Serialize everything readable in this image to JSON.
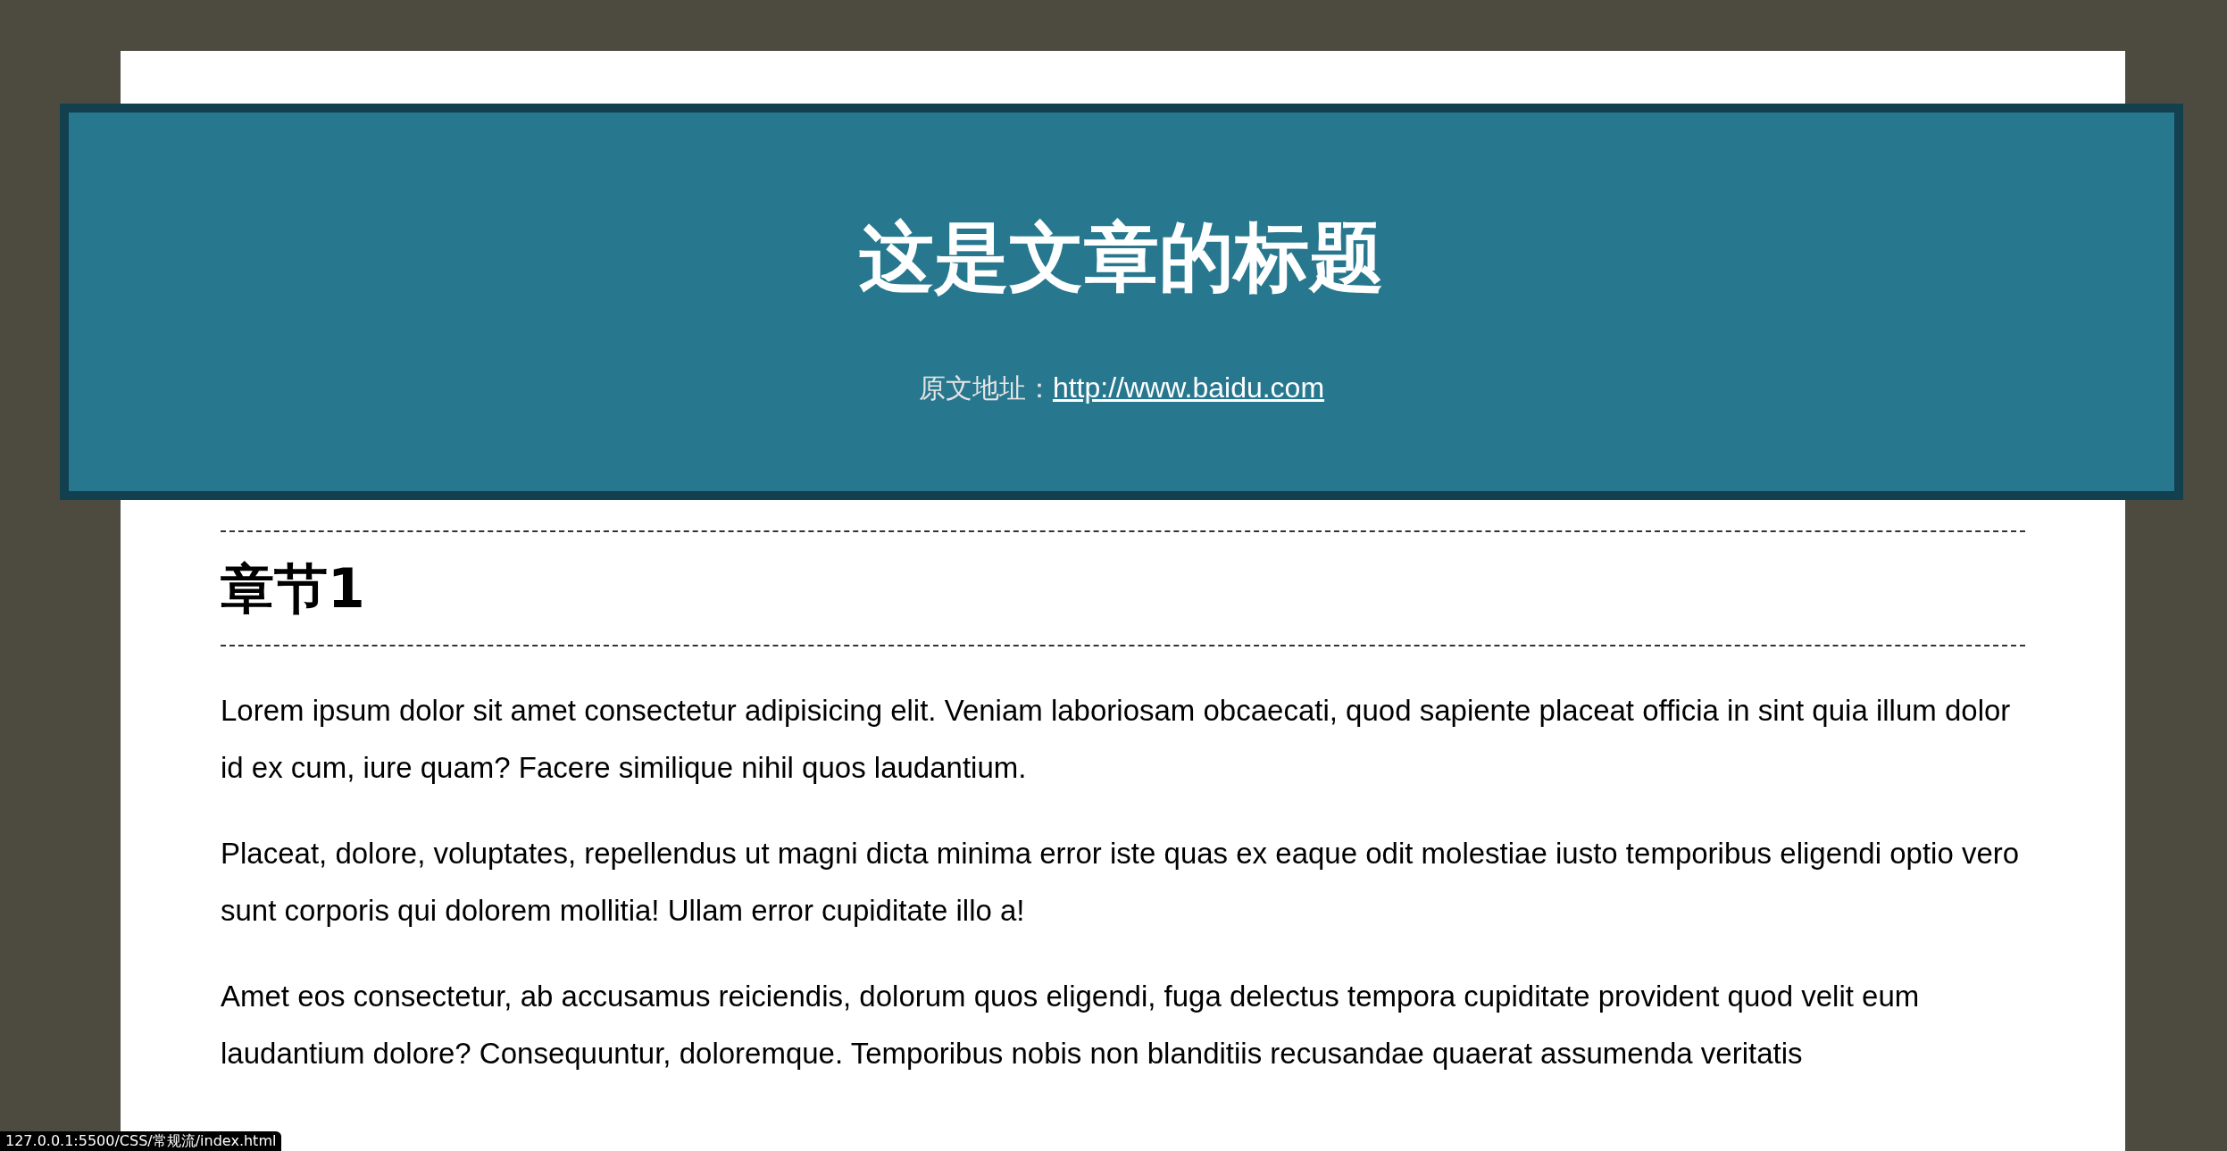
{
  "header": {
    "title": "这是文章的标题",
    "source_label": "原文地址：",
    "source_link": "http://www.baidu.com"
  },
  "section": {
    "heading": "章节1",
    "paragraphs": [
      "Lorem ipsum dolor sit amet consectetur adipisicing elit. Veniam laboriosam obcaecati, quod sapiente placeat officia in sint quia illum dolor id ex cum, iure quam? Facere similique nihil quos laudantium.",
      "Placeat, dolore, voluptates, repellendus ut magni dicta minima error iste quas ex eaque odit molestiae iusto temporibus eligendi optio vero sunt corporis qui dolorem mollitia! Ullam error cupiditate illo a!",
      "Amet eos consectetur, ab accusamus reiciendis, dolorum quos eligendi, fuga delectus tempora cupiditate provident quod velit eum laudantium dolore? Consequuntur, doloremque. Temporibus nobis non blanditiis recusandae quaerat assumenda veritatis"
    ]
  },
  "status_bar": {
    "url": "127.0.0.1:5500/CSS/常规流/index.html"
  }
}
